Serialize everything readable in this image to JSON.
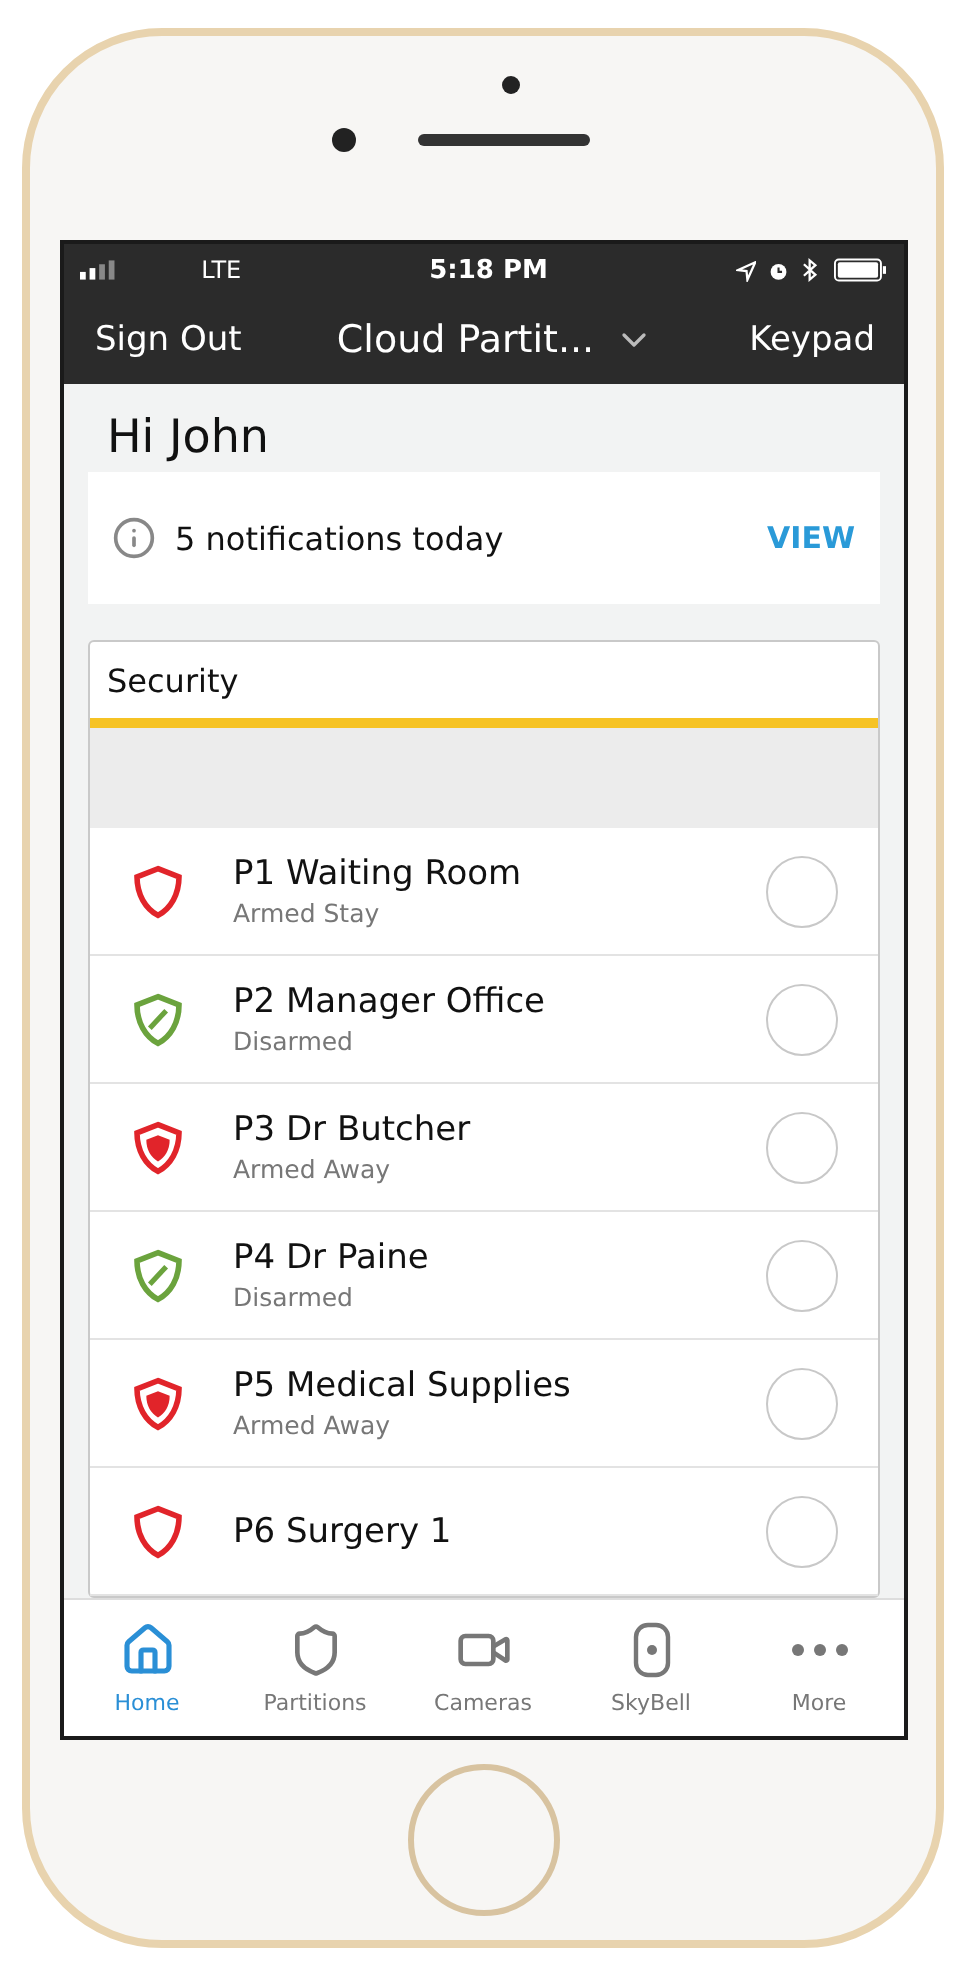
{
  "status_bar": {
    "carrier": "LTE",
    "time": "5:18 PM"
  },
  "nav": {
    "left": "Sign Out",
    "title": "Cloud Partit...",
    "right": "Keypad"
  },
  "greeting": "Hi John",
  "notification": {
    "text": "5 notifications today",
    "action": "VIEW"
  },
  "security": {
    "title": "Security",
    "partitions": [
      {
        "name": "P1 Waiting Room",
        "status": "Armed Stay",
        "kind": "armed_stay",
        "selected": false
      },
      {
        "name": "P2 Manager Office",
        "status": "Disarmed",
        "kind": "disarmed",
        "selected": false
      },
      {
        "name": "P3 Dr Butcher",
        "status": "Armed Away",
        "kind": "armed_away",
        "selected": false
      },
      {
        "name": "P4 Dr Paine",
        "status": "Disarmed",
        "kind": "disarmed",
        "selected": false
      },
      {
        "name": "P5 Medical Supplies",
        "status": "Armed Away",
        "kind": "armed_away",
        "selected": false
      },
      {
        "name": "P6 Surgery 1",
        "kind": "armed_stay",
        "selected": false
      }
    ]
  },
  "tabs": [
    {
      "label": "Home",
      "kind": "home",
      "selected": true
    },
    {
      "label": "Partitions",
      "kind": "partitions",
      "selected": false
    },
    {
      "label": "Cameras",
      "kind": "cameras",
      "selected": false
    },
    {
      "label": "SkyBell",
      "kind": "skybell",
      "selected": false
    },
    {
      "label": "More",
      "kind": "more",
      "selected": false
    }
  ]
}
